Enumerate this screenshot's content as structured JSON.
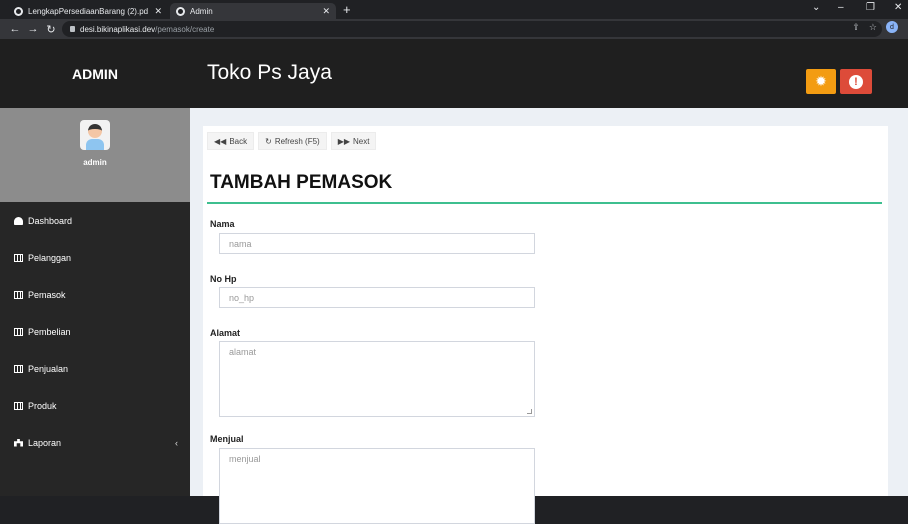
{
  "browser": {
    "tabs": [
      {
        "title": "LengkapPersediaanBarang (2).pd"
      },
      {
        "title": "Admin"
      }
    ],
    "url_host": "desi.bikinaplikasi.dev",
    "url_path": "/pemasok/create",
    "profile_initial": "d"
  },
  "sidebar": {
    "brand": "ADMIN",
    "username": "admin",
    "items": [
      {
        "label": "Dashboard"
      },
      {
        "label": "Pelanggan"
      },
      {
        "label": "Pemasok"
      },
      {
        "label": "Pembelian"
      },
      {
        "label": "Penjualan"
      },
      {
        "label": "Produk"
      },
      {
        "label": "Laporan"
      }
    ]
  },
  "header": {
    "title": "Toko Ps Jaya"
  },
  "toolbar": {
    "back_label": "Back",
    "refresh_label": "Refresh (F5)",
    "next_label": "Next"
  },
  "form": {
    "title": "TAMBAH PEMASOK",
    "fields": [
      {
        "label": "Nama",
        "placeholder": "nama"
      },
      {
        "label": "No Hp",
        "placeholder": "no_hp"
      },
      {
        "label": "Alamat",
        "placeholder": "alamat"
      },
      {
        "label": "Menjual",
        "placeholder": "menjual"
      }
    ]
  },
  "colors": {
    "accent_green": "#3dbf8f",
    "warning": "#f39c12",
    "danger": "#dd4b39",
    "sidebar_bg": "#262626"
  }
}
